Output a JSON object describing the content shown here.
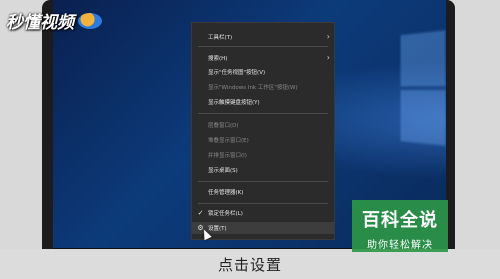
{
  "watermark": {
    "text": "秒懂视频"
  },
  "context_menu": {
    "items": [
      {
        "label": "工具栏(T)",
        "enabled": true,
        "submenu": true
      },
      {
        "label": "搜索(H)",
        "enabled": true,
        "submenu": true
      },
      {
        "label": "显示\"任务视图\"按钮(V)",
        "enabled": true
      },
      {
        "label": "显示\"Windows Ink 工作区\"按钮(W)",
        "enabled": false
      },
      {
        "label": "显示触摸键盘按钮(Y)",
        "enabled": true
      },
      {
        "label": "层叠窗口(D)",
        "enabled": false
      },
      {
        "label": "堆叠显示窗口(E)",
        "enabled": false
      },
      {
        "label": "并排显示窗口(I)",
        "enabled": false
      },
      {
        "label": "显示桌面(S)",
        "enabled": true
      },
      {
        "label": "任务管理器(K)",
        "enabled": true
      },
      {
        "label": "锁定任务栏(L)",
        "enabled": true,
        "checked": true
      },
      {
        "label": "设置(T)",
        "enabled": true,
        "hovered": true
      }
    ]
  },
  "caption": {
    "text": "点击设置"
  },
  "baike": {
    "title": "百科全说",
    "subtitle": "助你轻松解决"
  },
  "colors": {
    "menu_bg": "#2b2b2b",
    "desktop": "#0c3b7a",
    "baike_green": "#2d9646"
  }
}
